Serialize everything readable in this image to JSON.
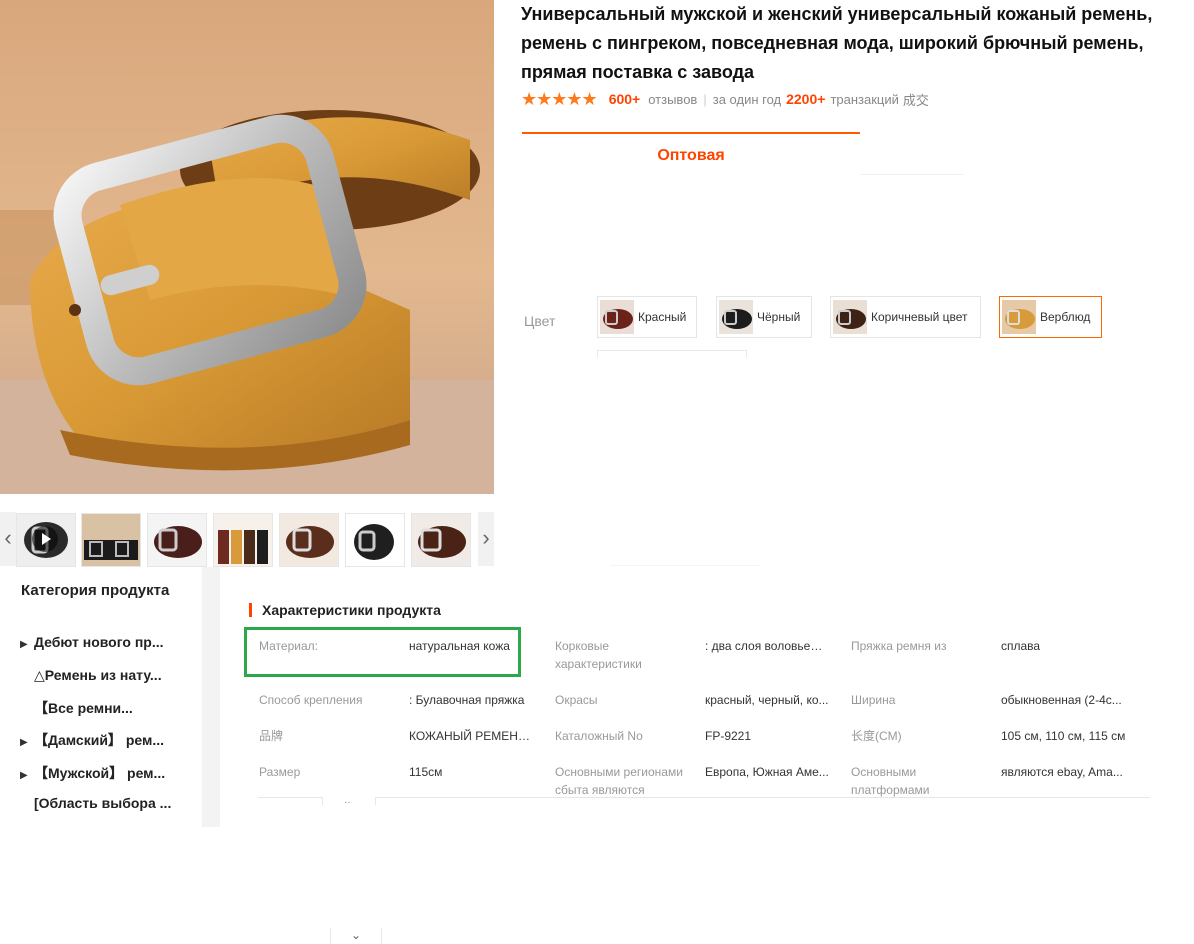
{
  "product": {
    "title": "Универсальный мужской и женский универсальный кожаный ремень, ремень с пингреком, повседневная мода, широкий брючный ремень, прямая поставка с завода",
    "stars": "★★★★★",
    "reviews_count": "600+",
    "reviews_label": "отзывов",
    "annual_label": "за один год",
    "transactions_count": "2200+",
    "transactions_label": "транзакций",
    "transactions_suffix": "成交"
  },
  "tabs": {
    "wholesale": "Оптовая"
  },
  "colors": {
    "label": "Цвет",
    "options": [
      "Красный",
      "Чёрный",
      "Коричневый цвет",
      "Верблюд"
    ],
    "selected": "Верблюд"
  },
  "gallery": {
    "prev": "‹",
    "next": "›",
    "thumb_icons": [
      "video-play-icon"
    ]
  },
  "sidebar": {
    "title": "Категория продукта",
    "items": [
      {
        "caret": "▶",
        "label": "Дебют нового пр..."
      },
      {
        "caret": "",
        "label": "△Ремень из нату..."
      },
      {
        "caret": "",
        "label": "【Все ремни..."
      },
      {
        "caret": "▶",
        "label": "【Дамский】 рем..."
      },
      {
        "caret": "▶",
        "label": "【Мужской】 рем..."
      },
      {
        "caret": "",
        "label": "[Область выбора ..."
      }
    ]
  },
  "specs": {
    "title": "Характеристики продукта",
    "rows": [
      [
        {
          "key": "Материал:",
          "value": "натуральная кожа"
        },
        {
          "key": "Корковые характеристики",
          "value": ": два слоя воловьей ..."
        },
        {
          "key": "Пряжка ремня из",
          "value": "сплава"
        }
      ],
      [
        {
          "key": "Способ крепления",
          "value": ": Булавочная пряжка"
        },
        {
          "key": "Окрасы",
          "value": "красный, черный, ко..."
        },
        {
          "key": "Ширина",
          "value": "обыкновенная (2-4с..."
        }
      ],
      [
        {
          "key": "品牌",
          "value": "КОЖАНЫЙ РЕМЕНЬ ..."
        },
        {
          "key": "Каталожный No",
          "value": "FP-9221"
        },
        {
          "key": "长度(CM)",
          "value": "105 см, 110 см, 115 см"
        }
      ],
      [
        {
          "key": "Размер",
          "value": "115см"
        },
        {
          "key": "Основными регионами сбыта являются",
          "value": "Европа, Южная Аме..."
        },
        {
          "key": "Основными платформами",
          "value": "являются ebay, Ama..."
        }
      ]
    ],
    "stray_mark": "··"
  },
  "footer": {
    "dropdown": "⌄"
  },
  "colors_palette": {
    "accent": "#ff4400",
    "tab_line": "#ff5a00",
    "highlight": "#2ba84a",
    "leather": "#d49a3f"
  }
}
